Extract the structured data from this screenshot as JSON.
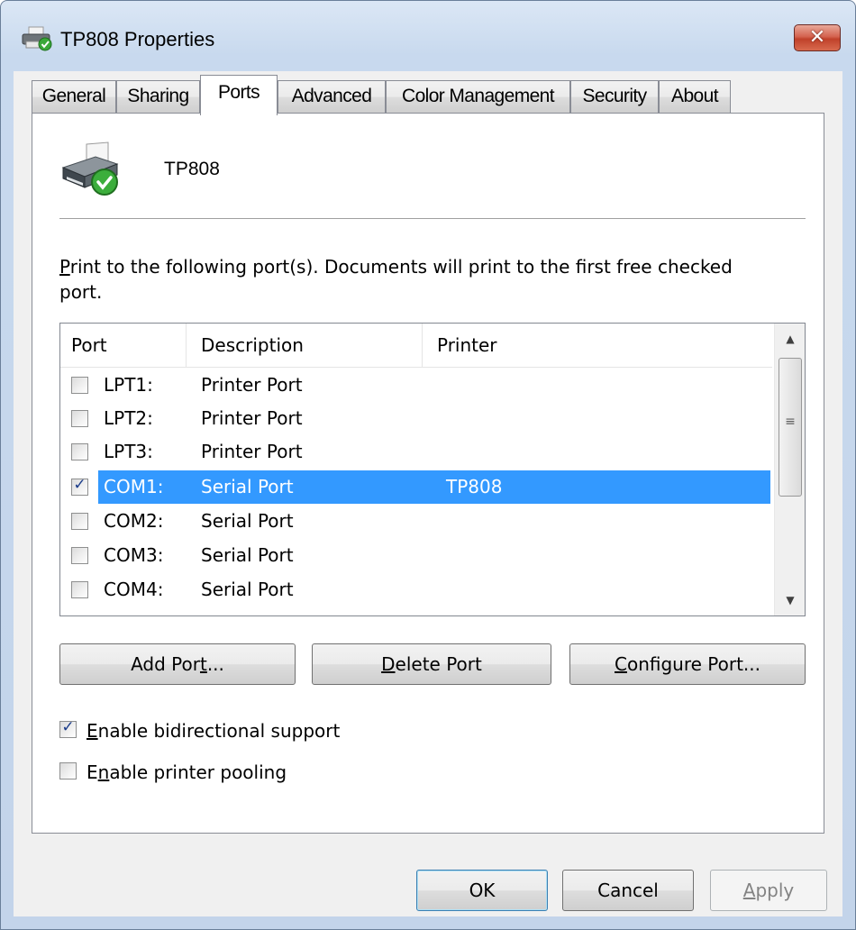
{
  "window": {
    "title": "TP808 Properties"
  },
  "tabs": [
    {
      "label": "General",
      "active": false
    },
    {
      "label": "Sharing",
      "active": false
    },
    {
      "label": "Ports",
      "active": true
    },
    {
      "label": "Advanced",
      "active": false
    },
    {
      "label": "Color Management",
      "active": false
    },
    {
      "label": "Security",
      "active": false
    },
    {
      "label": "About",
      "active": false
    }
  ],
  "printer": {
    "name": "TP808"
  },
  "instructions": {
    "pre": "",
    "mnemonic": "P",
    "post": "rint to the following port(s). Documents will print to the first free checked port."
  },
  "ports_list": {
    "columns": [
      "Port",
      "Description",
      "Printer"
    ],
    "rows": [
      {
        "port": "LPT1:",
        "description": "Printer Port",
        "printer": "",
        "checked": false,
        "selected": false
      },
      {
        "port": "LPT2:",
        "description": "Printer Port",
        "printer": "",
        "checked": false,
        "selected": false
      },
      {
        "port": "LPT3:",
        "description": "Printer Port",
        "printer": "",
        "checked": false,
        "selected": false
      },
      {
        "port": "COM1:",
        "description": "Serial Port",
        "printer": "TP808",
        "checked": true,
        "selected": true
      },
      {
        "port": "COM2:",
        "description": "Serial Port",
        "printer": "",
        "checked": false,
        "selected": false
      },
      {
        "port": "COM3:",
        "description": "Serial Port",
        "printer": "",
        "checked": false,
        "selected": false
      },
      {
        "port": "COM4:",
        "description": "Serial Port",
        "printer": "",
        "checked": false,
        "selected": false
      }
    ]
  },
  "port_buttons": {
    "add": {
      "pre": "Add Por",
      "mnemonic": "t",
      "post": "..."
    },
    "delete": {
      "pre": "",
      "mnemonic": "D",
      "post": "elete Port"
    },
    "configure": {
      "pre": "",
      "mnemonic": "C",
      "post": "onfigure Port..."
    }
  },
  "options": {
    "bidirectional": {
      "pre": "",
      "mnemonic": "E",
      "post": "nable bidirectional support",
      "checked": true
    },
    "pooling": {
      "pre": "E",
      "mnemonic": "n",
      "post": "able printer pooling",
      "checked": false
    }
  },
  "dialog_buttons": {
    "ok": "OK",
    "cancel": "Cancel",
    "apply": {
      "pre": "",
      "mnemonic": "A",
      "post": "pply"
    }
  },
  "colors": {
    "selection": "#3399ff",
    "close_button": "#c7432d"
  }
}
